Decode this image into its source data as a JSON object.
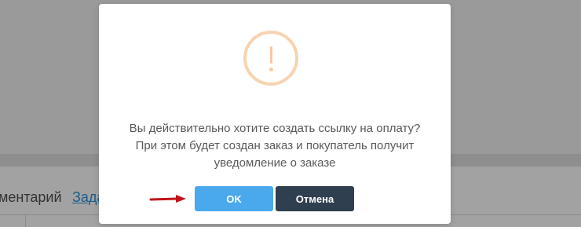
{
  "background": {
    "comment_label": "ментарий",
    "link_label": "Зада"
  },
  "dialog": {
    "icon": "exclamation-warning-icon",
    "icon_color": "#f8d3b1",
    "message_lines": [
      "Вы действительно хотите создать ссылку на оплату?",
      "При этом будет создан заказ и покупатель получит",
      "уведомление о заказе"
    ],
    "ok_label": "OK",
    "cancel_label": "Отмена",
    "ok_color": "#4aa8ec",
    "cancel_color": "#2f3f4f"
  },
  "annotation": {
    "arrow_color": "#c0141c",
    "icon": "red-arrow-pointer-icon"
  }
}
